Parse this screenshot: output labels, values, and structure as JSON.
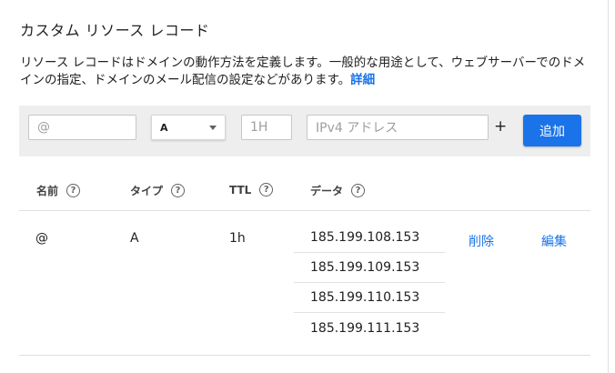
{
  "title": "カスタム リソース レコード",
  "description": {
    "text": "リソース レコードはドメインの動作方法を定義します。一般的な用途として、ウェブサーバーでのドメインの指定、ドメインのメール配信の設定などがあります。",
    "link": "詳細"
  },
  "form": {
    "name_placeholder": "@",
    "type_value": "A",
    "ttl_placeholder": "1H",
    "data_placeholder": "IPv4 アドレス",
    "plus_label": "+",
    "add_button": "追加"
  },
  "table": {
    "headers": [
      {
        "label": "名前",
        "help": "?"
      },
      {
        "label": "タイプ",
        "help": "?"
      },
      {
        "label": "TTL",
        "help": "?"
      },
      {
        "label": "データ",
        "help": "?"
      }
    ],
    "rows": [
      {
        "name": "@",
        "type": "A",
        "ttl": "1h",
        "data": [
          "185.199.108.153",
          "185.199.109.153",
          "185.199.110.153",
          "185.199.111.153"
        ],
        "delete_label": "削除",
        "edit_label": "編集"
      }
    ]
  },
  "colors": {
    "accent": "#1a73e8",
    "form_bg": "#eeeeee"
  },
  "icons": {
    "help": "help-circle-icon",
    "dropdown": "caret-down-icon"
  }
}
